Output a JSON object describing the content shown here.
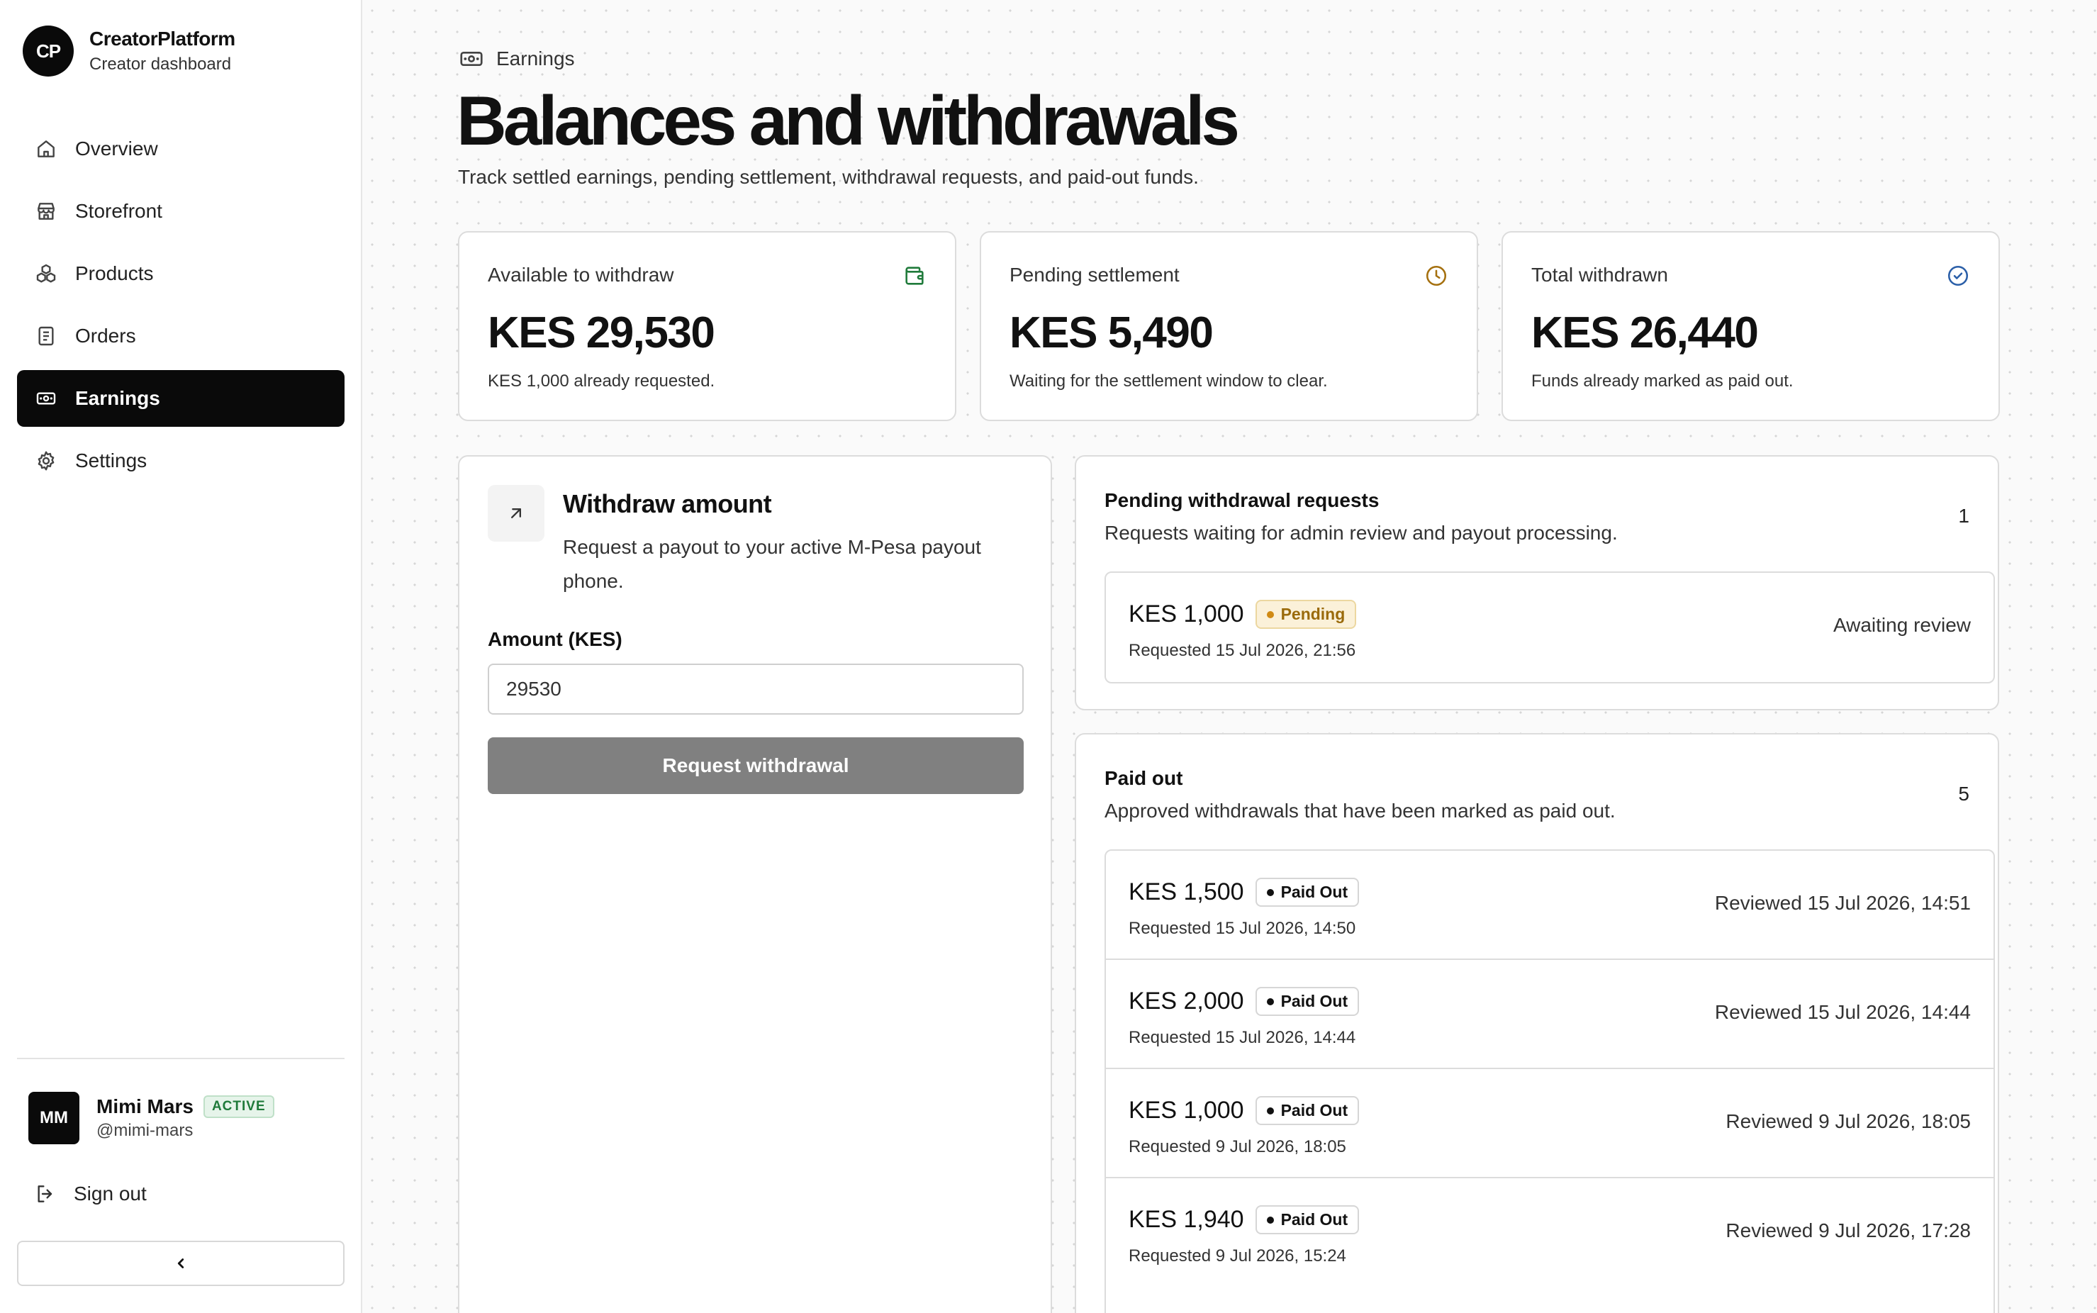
{
  "brand": {
    "logo": "CP",
    "name": "CreatorPlatform",
    "subtitle": "Creator dashboard"
  },
  "nav": [
    {
      "label": "Overview",
      "icon": "home-icon"
    },
    {
      "label": "Storefront",
      "icon": "store-icon"
    },
    {
      "label": "Products",
      "icon": "products-icon"
    },
    {
      "label": "Orders",
      "icon": "orders-icon"
    },
    {
      "label": "Earnings",
      "icon": "banknote-icon",
      "active": true
    },
    {
      "label": "Settings",
      "icon": "gear-icon"
    }
  ],
  "user": {
    "initials": "MM",
    "name": "Mimi Mars",
    "status": "ACTIVE",
    "handle": "@mimi-mars"
  },
  "signout_label": "Sign out",
  "header": {
    "breadcrumb": "Earnings",
    "title": "Balances and withdrawals",
    "subtitle": "Track settled earnings, pending settlement, withdrawal requests, and paid-out funds."
  },
  "stats": [
    {
      "label": "Available to withdraw",
      "value": "KES 29,530",
      "note": "KES 1,000 already requested.",
      "icon": "wallet-icon",
      "color": "#1f7a3a"
    },
    {
      "label": "Pending settlement",
      "value": "KES 5,490",
      "note": "Waiting for the settlement window to clear.",
      "icon": "clock-icon",
      "color": "#a5700f"
    },
    {
      "label": "Total withdrawn",
      "value": "KES 26,440",
      "note": "Funds already marked as paid out.",
      "icon": "check-circle-icon",
      "color": "#2b5fa8"
    }
  ],
  "withdraw": {
    "title": "Withdraw amount",
    "description": "Request a payout to your active M-Pesa payout phone.",
    "amount_label": "Amount (KES)",
    "amount_value": "29530",
    "button_label": "Request withdrawal"
  },
  "pending": {
    "title": "Pending withdrawal requests",
    "description": "Requests waiting for admin review and payout processing.",
    "count": "1",
    "items": [
      {
        "amount": "KES 1,000",
        "status": "Pending",
        "requested": "Requested 15 Jul 2026, 21:56",
        "right": "Awaiting review"
      }
    ]
  },
  "paid": {
    "title": "Paid out",
    "description": "Approved withdrawals that have been marked as paid out.",
    "count": "5",
    "items": [
      {
        "amount": "KES 1,500",
        "status": "Paid Out",
        "requested": "Requested 15 Jul 2026, 14:50",
        "right": "Reviewed 15 Jul 2026, 14:51"
      },
      {
        "amount": "KES 2,000",
        "status": "Paid Out",
        "requested": "Requested 15 Jul 2026, 14:44",
        "right": "Reviewed 15 Jul 2026, 14:44"
      },
      {
        "amount": "KES 1,000",
        "status": "Paid Out",
        "requested": "Requested 9 Jul 2026, 18:05",
        "right": "Reviewed 9 Jul 2026, 18:05"
      },
      {
        "amount": "KES 1,940",
        "status": "Paid Out",
        "requested": "Requested 9 Jul 2026, 15:24",
        "right": "Reviewed 9 Jul 2026, 17:28"
      }
    ]
  }
}
